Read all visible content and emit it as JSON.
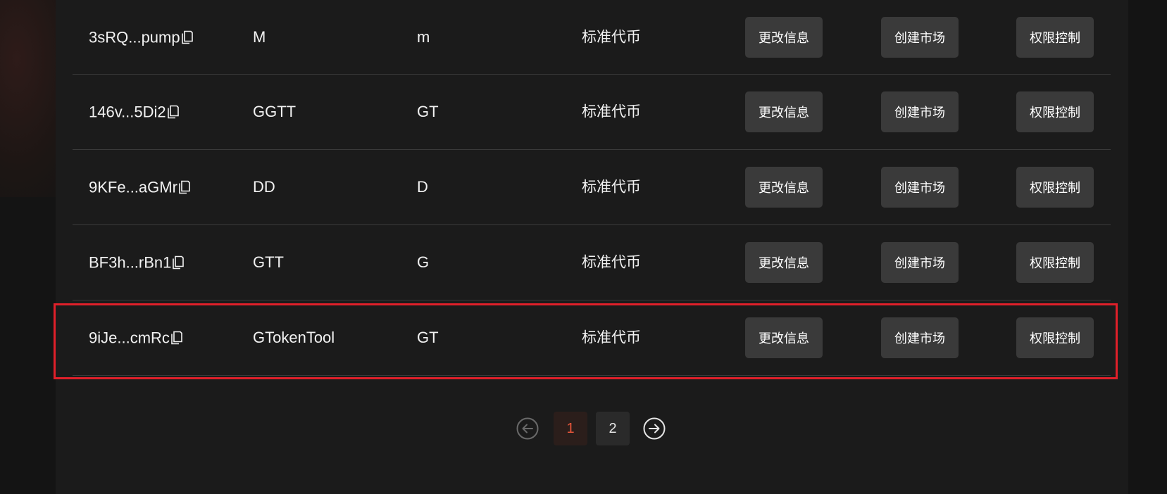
{
  "rows": [
    {
      "address": "3sRQ...pump",
      "name": "M",
      "symbol": "m",
      "type": "标准代币",
      "btn_edit": "更改信息",
      "btn_market": "创建市场",
      "btn_perm": "权限控制"
    },
    {
      "address": "146v...5Di2",
      "name": "GGTT",
      "symbol": "GT",
      "type": "标准代币",
      "btn_edit": "更改信息",
      "btn_market": "创建市场",
      "btn_perm": "权限控制"
    },
    {
      "address": "9KFe...aGMr",
      "name": "DD",
      "symbol": "D",
      "type": "标准代币",
      "btn_edit": "更改信息",
      "btn_market": "创建市场",
      "btn_perm": "权限控制"
    },
    {
      "address": "BF3h...rBn1",
      "name": "GTT",
      "symbol": "G",
      "type": "标准代币",
      "btn_edit": "更改信息",
      "btn_market": "创建市场",
      "btn_perm": "权限控制"
    },
    {
      "address": "9iJe...cmRc",
      "name": "GTokenTool",
      "symbol": "GT",
      "type": "标准代币",
      "btn_edit": "更改信息",
      "btn_market": "创建市场",
      "btn_perm": "权限控制"
    }
  ],
  "highlighted_row": 4,
  "pagination": {
    "pages": [
      "1",
      "2"
    ],
    "current_page": "1",
    "prev_icon": "arrow-left-circle-icon",
    "next_icon": "arrow-right-circle-icon"
  },
  "colors": {
    "background": "#141414",
    "panel": "#1b1b1b",
    "button": "#3a3a3a",
    "highlight_border": "#e0202a",
    "active_page": "#e8563a"
  },
  "icons": {
    "copy": "copy-icon"
  }
}
